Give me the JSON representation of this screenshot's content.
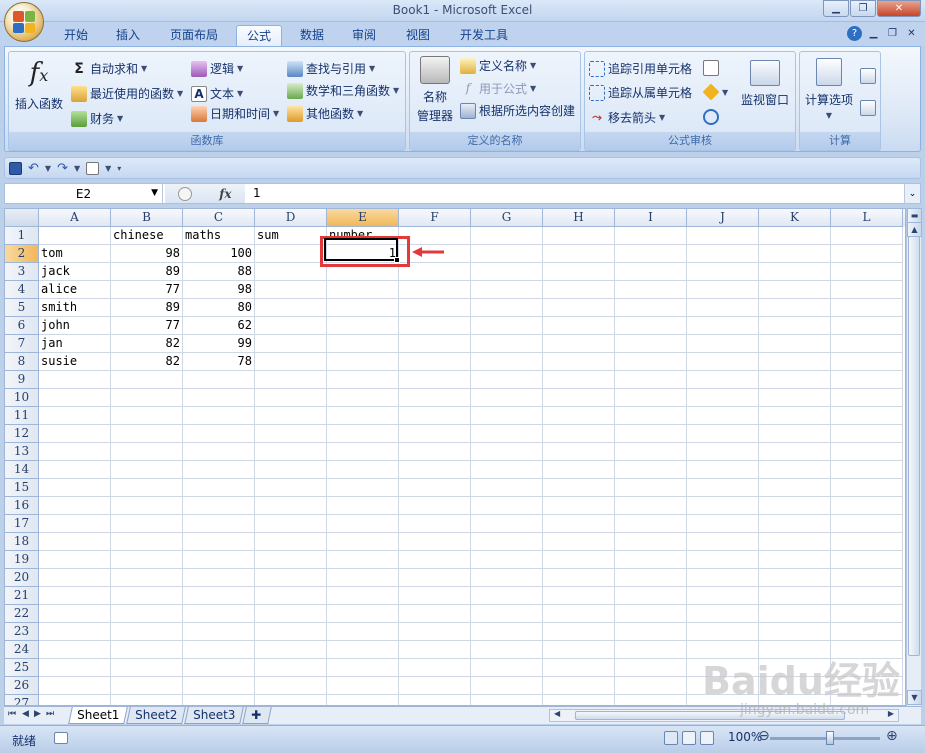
{
  "window": {
    "title": "Book1 - Microsoft Excel"
  },
  "tabs": [
    {
      "label": "开始"
    },
    {
      "label": "插入"
    },
    {
      "label": "页面布局"
    },
    {
      "label": "公式",
      "active": true
    },
    {
      "label": "数据"
    },
    {
      "label": "审阅"
    },
    {
      "label": "视图"
    },
    {
      "label": "开发工具"
    }
  ],
  "ribbon": {
    "function_library": {
      "label": "函数库",
      "insert_function": "插入函数",
      "autosum": "自动求和",
      "recent": "最近使用的函数",
      "financial": "财务",
      "logical": "逻辑",
      "text": "文本",
      "datetime": "日期和时间",
      "lookup": "查找与引用",
      "math": "数学和三角函数",
      "more": "其他函数"
    },
    "defined_names": {
      "label": "定义的名称",
      "name_manager_1": "名称",
      "name_manager_2": "管理器",
      "define_name": "定义名称",
      "use_in_formula": "用于公式",
      "create_from_selection": "根据所选内容创建"
    },
    "formula_auditing": {
      "label": "公式审核",
      "trace_precedents": "追踪引用单元格",
      "trace_dependents": "追踪从属单元格",
      "remove_arrows": "移去箭头",
      "watch_window": "监视窗口"
    },
    "calculation": {
      "label": "计算",
      "options": "计算选项"
    }
  },
  "formula_bar": {
    "name_box": "E2",
    "fx": "fx",
    "value": "1"
  },
  "columns": [
    {
      "label": "A"
    },
    {
      "label": "B"
    },
    {
      "label": "C"
    },
    {
      "label": "D"
    },
    {
      "label": "E",
      "selected": true
    },
    {
      "label": "F"
    },
    {
      "label": "G"
    },
    {
      "label": "H"
    },
    {
      "label": "I"
    },
    {
      "label": "J"
    },
    {
      "label": "K"
    },
    {
      "label": "L"
    }
  ],
  "rows": [
    [
      "1",
      "",
      "chinese",
      "maths",
      "sum",
      "number"
    ],
    [
      "2",
      "tom",
      "98",
      "100",
      "",
      "1"
    ],
    [
      "3",
      "jack",
      "89",
      "88",
      "",
      ""
    ],
    [
      "4",
      "alice",
      "77",
      "98",
      "",
      ""
    ],
    [
      "5",
      "smith",
      "89",
      "80",
      "",
      ""
    ],
    [
      "6",
      "john",
      "77",
      "62",
      "",
      ""
    ],
    [
      "7",
      "jan",
      "82",
      "99",
      "",
      ""
    ],
    [
      "8",
      "susie",
      "82",
      "78",
      "",
      ""
    ],
    [
      "9"
    ],
    [
      "10"
    ],
    [
      "11"
    ],
    [
      "12"
    ],
    [
      "13"
    ],
    [
      "14"
    ],
    [
      "15"
    ],
    [
      "16"
    ],
    [
      "17"
    ],
    [
      "18"
    ],
    [
      "19"
    ],
    [
      "20"
    ],
    [
      "21"
    ],
    [
      "22"
    ],
    [
      "23"
    ],
    [
      "24"
    ],
    [
      "25"
    ],
    [
      "26"
    ],
    [
      "27"
    ]
  ],
  "sheets": [
    {
      "label": "Sheet1",
      "active": true
    },
    {
      "label": "Sheet2"
    },
    {
      "label": "Sheet3"
    }
  ],
  "status": {
    "ready": "就绪",
    "zoom": "100%"
  },
  "watermark": {
    "main": "Baidu经验",
    "sub": "jingyan.baidu.com"
  },
  "colors": {
    "accent": "#15428b",
    "highlight": "#e23a3a",
    "selected_header": "#f1b75a"
  }
}
